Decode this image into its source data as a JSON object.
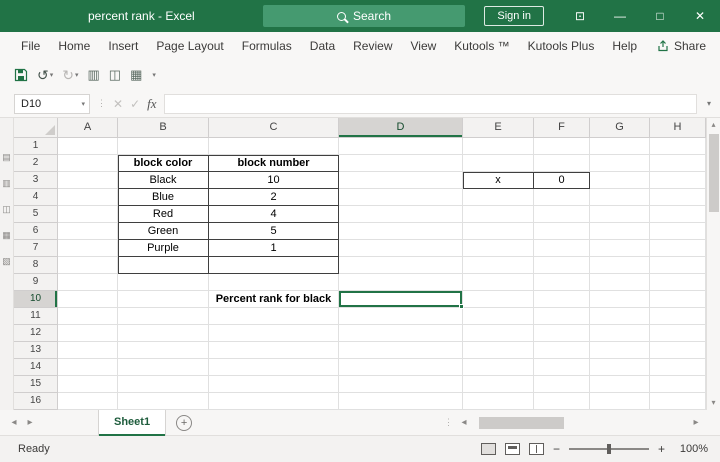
{
  "titlebar": {
    "title": "percent rank - Excel",
    "search_label": "Search",
    "sign_in_label": "Sign in"
  },
  "ribbon": {
    "tabs": [
      "File",
      "Home",
      "Insert",
      "Page Layout",
      "Formulas",
      "Data",
      "Review",
      "View",
      "Kutools ™",
      "Kutools Plus",
      "Help"
    ],
    "share_label": "Share"
  },
  "formula_bar": {
    "name_box_value": "D10",
    "formula_value": ""
  },
  "spreadsheet": {
    "column_headers": [
      "A",
      "B",
      "C",
      "D",
      "E",
      "F",
      "G",
      "H"
    ],
    "row_count": 16,
    "selected_cell": "D10",
    "selected_column": "D",
    "selected_row": "10",
    "accent_color": "#217346",
    "cells": {
      "B2": "block color",
      "C2": "block number",
      "B3": "Black",
      "C3": "10",
      "B4": "Blue",
      "C4": "2",
      "B5": "Red",
      "C5": "4",
      "B6": "Green",
      "C6": "5",
      "B7": "Purple",
      "C7": "1",
      "E3": "x",
      "F3": "0",
      "C10": "Percent rank for black"
    }
  },
  "sheet_bar": {
    "tabs": [
      {
        "label": "Sheet1",
        "active": true
      }
    ]
  },
  "status_bar": {
    "mode_label": "Ready",
    "zoom_label": "100%"
  },
  "icons": {
    "undo": "↺",
    "redo": "↻",
    "dropdown": "▾",
    "cancel": "✕",
    "enter": "✓",
    "insert_function": "fx",
    "book": "▥",
    "print_preview": "◫",
    "table_borders": "▦",
    "minimize": "—",
    "maximize": "□",
    "close": "✕",
    "ribbon_options": "⊡",
    "scroll_up": "▴",
    "scroll_down": "▾",
    "scroll_left": "◂",
    "scroll_right": "▸",
    "add_sheet": "+",
    "splitter": "⋮",
    "zoom_out": "−",
    "zoom_in": "+",
    "pane_doc": "▤",
    "pane_list": "▥",
    "pane_print": "◫",
    "pane_grid": "▦",
    "pane_find": "▧"
  }
}
